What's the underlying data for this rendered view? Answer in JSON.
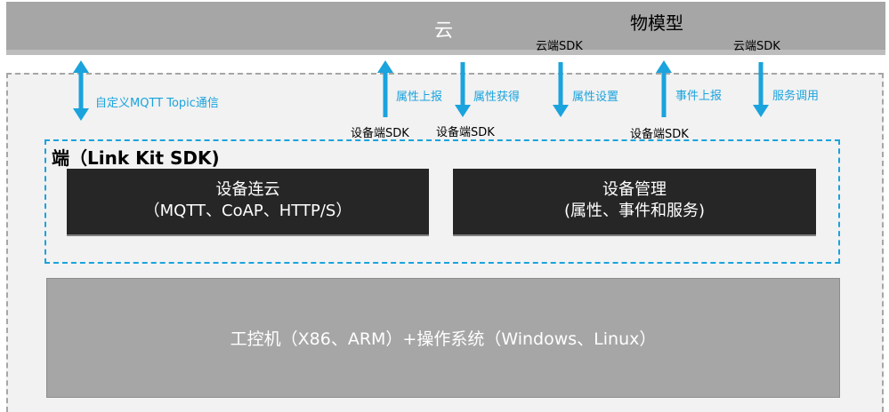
{
  "cloud": {
    "title": "云",
    "thing_model": "物模型",
    "cloud_sdk_1": "云端SDK",
    "cloud_sdk_2": "云端SDK"
  },
  "arrows": {
    "custom_topic": "自定义MQTT Topic通信",
    "prop_report": "属性上报",
    "prop_get": "属性获得",
    "prop_set": "属性设置",
    "event_report": "事件上报",
    "service_call": "服务调用"
  },
  "device_sdk_labels": [
    "设备端SDK",
    "设备端SDK",
    "设备端SDK"
  ],
  "edge": {
    "title": "端（Link Kit SDK)",
    "connect": {
      "line1": "设备连云",
      "line2": "（MQTT、CoAP、HTTP/S）"
    },
    "manage": {
      "line1": "设备管理",
      "line2": "(属性、事件和服务)"
    }
  },
  "os_text": "工控机（X86、ARM）+操作系统（Windows、Linux）",
  "colors": {
    "accent": "#1aa3dd",
    "cloud_bar": "#a6a6a6",
    "dark_box": "#262626",
    "region_bg": "#f2f2f2"
  }
}
